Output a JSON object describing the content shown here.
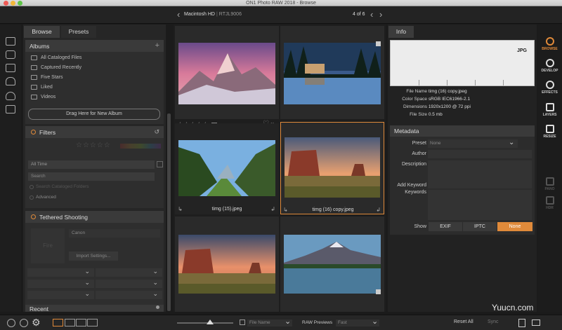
{
  "window": {
    "title": "ON1 Photo RAW 2018 - Browse"
  },
  "path": {
    "location": "Macintosh HD",
    "folder": "RTJL9006",
    "count": "4 of 6"
  },
  "left_tabs": [
    {
      "label": "Browse"
    },
    {
      "label": "Presets"
    }
  ],
  "albums": {
    "title": "Albums",
    "items": [
      "All Cataloged Files",
      "Captured Recently",
      "Five Stars",
      "Liked",
      "Videos"
    ],
    "drag_label": "Drag Here for New Album"
  },
  "filters": {
    "title": "Filters",
    "date_value": "All Time",
    "search_placeholder": "Search",
    "search_catalog": "Search Cataloged Folders",
    "advanced": "Advanced"
  },
  "tethered": {
    "title": "Tethered Shooting",
    "camera": "Canon",
    "fire": "Fire",
    "import_settings": "Import Settings..."
  },
  "recent": {
    "title": "Recent"
  },
  "grid": {
    "captions": [
      "timg (15).jpeg",
      "timg (16) copy.jpeg"
    ],
    "selected_index": 3
  },
  "info": {
    "tab": "Info",
    "file_type": "JPG",
    "rows": [
      {
        "k": "File Name",
        "v": "timg (16) copy.jpeg"
      },
      {
        "k": "Color Space",
        "v": "sRGB IEC61966-2.1"
      },
      {
        "k": "Dimensions",
        "v": "1920x1200 @ 72 ppi"
      },
      {
        "k": "File Size",
        "v": "0.5 mb"
      }
    ]
  },
  "metadata": {
    "title": "Metadata",
    "preset_label": "Preset",
    "preset_value": "None",
    "author_label": "Author",
    "description_label": "Description",
    "add_keyword_label": "Add Keyword",
    "keywords_label": "Keywords",
    "show_label": "Show",
    "show_options": [
      "EXIF",
      "IPTC",
      "None"
    ],
    "show_selected": "None"
  },
  "modules": [
    {
      "label": "BROWSE",
      "icon": "browse-icon",
      "active": true
    },
    {
      "label": "DEVELOP",
      "icon": "develop-icon",
      "active": false
    },
    {
      "label": "EFFECTS",
      "icon": "effects-icon",
      "active": false
    },
    {
      "label": "LAYERS",
      "icon": "layers-icon",
      "active": false
    },
    {
      "label": "RESIZE",
      "icon": "resize-icon",
      "active": false
    },
    {
      "label": "PANO",
      "icon": "pano-icon",
      "active": false
    },
    {
      "label": "HDR",
      "icon": "hdr-icon",
      "active": false
    }
  ],
  "bottom": {
    "sort_value": "File Name",
    "raw_previews_label": "RAW Previews",
    "raw_previews_value": "Fast",
    "reset_all": "Reset All",
    "sync": "Sync"
  },
  "watermark": "Yuucn.com",
  "colors": {
    "accent": "#e08a3a",
    "panel": "#262626",
    "header": "#3a3a3a"
  }
}
